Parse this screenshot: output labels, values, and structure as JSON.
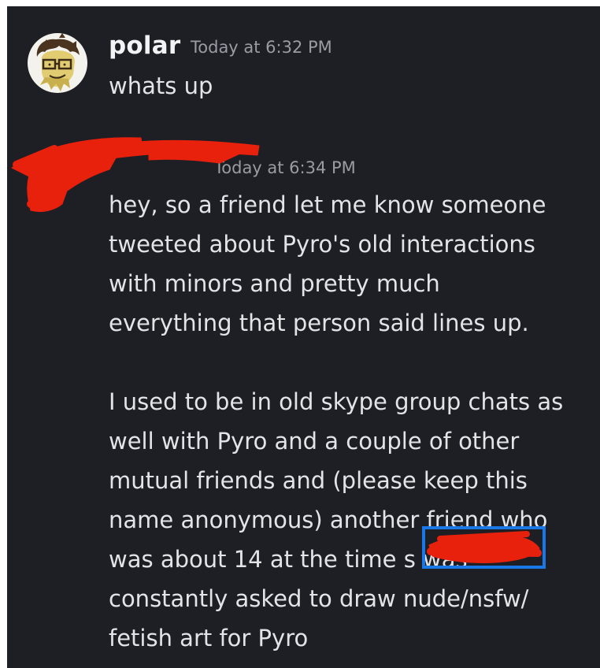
{
  "message_1": {
    "username": "polar",
    "timestamp": "Today at 6:32 PM",
    "text": "whats up"
  },
  "message_2": {
    "timestamp": "Today at 6:34 PM",
    "lines": [
      "hey, so a friend let me know someone",
      "tweeted about Pyro's old interactions",
      "with minors and pretty much",
      "everything that person said lines up.",
      "",
      "I used to be in old skype group chats as",
      "well with Pyro and a couple of other",
      "mutual friends and (please keep this",
      "name anonymous) another friend who",
      "was about 14 at the time        s was",
      "constantly asked to draw nude/nsfw/",
      "fetish art for Pyro"
    ]
  },
  "colors": {
    "background": "#1e1f24",
    "text": "#e3e4e8",
    "timestamp": "#9a9ca3",
    "redaction": "#e8210d",
    "highlight": "#1a78e6"
  }
}
